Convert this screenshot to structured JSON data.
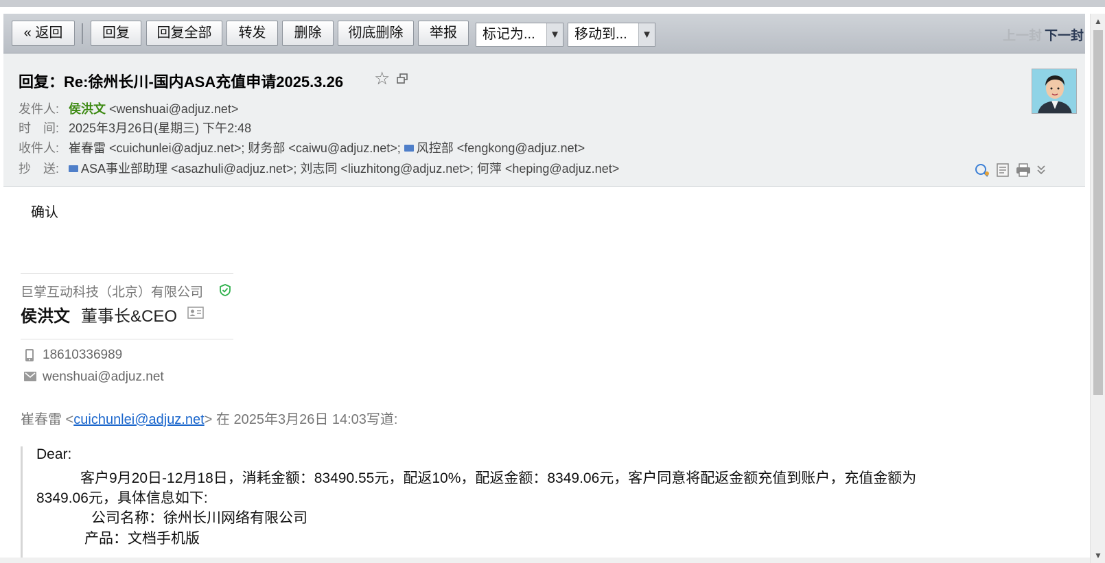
{
  "toolbar": {
    "back": "« 返回",
    "reply": "回复",
    "reply_all": "回复全部",
    "forward": "转发",
    "delete": "删除",
    "delete_permanent": "彻底删除",
    "report": "举报",
    "mark_as": "标记为...",
    "move_to": "移动到...",
    "prev": "上一封",
    "next": "下一封"
  },
  "header": {
    "subject": "回复：Re:徐州长川-国内ASA充值申请2025.3.26",
    "from_label": "发件人:",
    "from_name": "侯洪文",
    "from_addr": "<wenshuai@adjuz.net>",
    "time_label": "时　间:",
    "time_value": "2025年3月26日(星期三) 下午2:48",
    "to_label": "收件人:",
    "to_part1": "崔春雷 <cuichunlei@adjuz.net>; 财务部 <caiwu@adjuz.net>; ",
    "to_part2": "风控部 <fengkong@adjuz.net>",
    "cc_label": "抄　送:",
    "cc_value": "ASA事业部助理 <asazhuli@adjuz.net>; 刘志同 <liuzhitong@adjuz.net>; 何萍 <heping@adjuz.net>"
  },
  "body": {
    "reply_text": "确认",
    "signature": {
      "company": "巨掌互动科技（北京）有限公司",
      "name": "侯洪文",
      "title": "董事长&CEO",
      "phone": "18610336989",
      "email": "wenshuai@adjuz.net"
    },
    "quote": {
      "intro_prefix": "崔春雷 <",
      "intro_link": "cuichunlei@adjuz.net",
      "intro_suffix": "> 在 2025年3月26日 14:03写道:",
      "line1": "Dear:",
      "line2": "客户9月20日-12月18日，消耗金额：83490.55元，配返10%，配返金额：8349.06元，客户同意将配返金额充值到账户，充值金额为",
      "line3": "8349.06元，具体信息如下:",
      "line4": "公司名称：徐州长川网络有限公司",
      "line5": "产品：文档手机版"
    }
  },
  "icons": {
    "star": "star-icon",
    "popout": "popout-icon",
    "search_mail": "search-mail-icon",
    "note": "note-icon",
    "print": "print-icon",
    "more": "chevron-double-down-icon"
  },
  "colors": {
    "sender_green": "#3d8a13",
    "link_blue": "#1a66cc",
    "toolbar_bg": "#c3c7cd",
    "header_bg": "#eef0f1"
  }
}
